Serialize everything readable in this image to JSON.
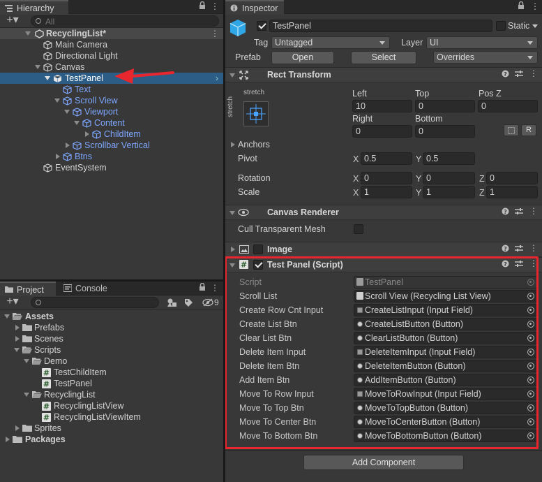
{
  "hierarchy": {
    "tab": "Hierarchy",
    "search_placeholder": "All",
    "scene": "RecyclingList*",
    "items": [
      "Main Camera",
      "Directional Light",
      "Canvas",
      "TestPanel",
      "Text",
      "Scroll View",
      "Viewport",
      "Content",
      "ChildItem",
      "Scrollbar Vertical",
      "Btns",
      "EventSystem"
    ]
  },
  "project": {
    "tabs": [
      "Project",
      "Console"
    ],
    "hidden_count": "9",
    "tree": [
      "Assets",
      "Prefabs",
      "Scenes",
      "Scripts",
      "Demo",
      "TestChildItem",
      "TestPanel",
      "RecyclingList",
      "RecyclingListView",
      "RecyclingListViewItem",
      "Sprites",
      "Packages"
    ]
  },
  "inspector": {
    "tab": "Inspector",
    "name": "TestPanel",
    "static_label": "Static",
    "tag_label": "Tag",
    "tag_value": "Untagged",
    "layer_label": "Layer",
    "layer_value": "UI",
    "prefab_label": "Prefab",
    "open": "Open",
    "select": "Select",
    "overrides": "Overrides",
    "rect": {
      "title": "Rect Transform",
      "anchor_preset": "stretch",
      "left_label": "Left",
      "top_label": "Top",
      "posz_label": "Pos Z",
      "left": "10",
      "top": "0",
      "posz": "0",
      "right_label": "Right",
      "bottom_label": "Bottom",
      "right": "0",
      "bottom": "0",
      "r_btn": "R",
      "anchors": "Anchors",
      "pivot": "Pivot",
      "pivot_x": "0.5",
      "pivot_y": "0.5",
      "rotation": "Rotation",
      "rot_x": "0",
      "rot_y": "0",
      "rot_z": "0",
      "scale": "Scale",
      "sc_x": "1",
      "sc_y": "1",
      "sc_z": "1",
      "x": "X",
      "y": "Y",
      "z": "Z"
    },
    "canvas_renderer": {
      "title": "Canvas Renderer",
      "cull": "Cull Transparent Mesh"
    },
    "image": {
      "title": "Image"
    },
    "script": {
      "title": "Test Panel (Script)",
      "fields": [
        {
          "label": "Script",
          "value": "TestPanel",
          "kind": "script"
        },
        {
          "label": "Scroll List",
          "value": "Scroll View (Recycling List View)",
          "kind": "script"
        },
        {
          "label": "Create Row Cnt Input",
          "value": "CreateListInput (Input Field)",
          "kind": "input"
        },
        {
          "label": "Create List Btn",
          "value": "CreateListButton (Button)",
          "kind": "button"
        },
        {
          "label": "Clear List Btn",
          "value": "ClearListButton (Button)",
          "kind": "button"
        },
        {
          "label": "Delete Item Input",
          "value": "DeleteItemInput (Input Field)",
          "kind": "input"
        },
        {
          "label": "Delete Item Btn",
          "value": "DeleteItemButton (Button)",
          "kind": "button"
        },
        {
          "label": "Add Item Btn",
          "value": "AddItemButton (Button)",
          "kind": "button"
        },
        {
          "label": "Move To Row Input",
          "value": "MoveToRowInput (Input Field)",
          "kind": "input"
        },
        {
          "label": "Move To Top Btn",
          "value": "MoveToTopButton (Button)",
          "kind": "button"
        },
        {
          "label": "Move To Center Btn",
          "value": "MoveToCenterButton (Button)",
          "kind": "button"
        },
        {
          "label": "Move To Bottom Btn",
          "value": "MoveToBottomButton (Button)",
          "kind": "button"
        }
      ]
    },
    "add_component": "Add Component"
  },
  "colors": {
    "selection": "#2c5d87",
    "prefab_blue": "#7ea7ff",
    "highlight_red": "#e8262d",
    "arrow_red": "#e8262d"
  }
}
